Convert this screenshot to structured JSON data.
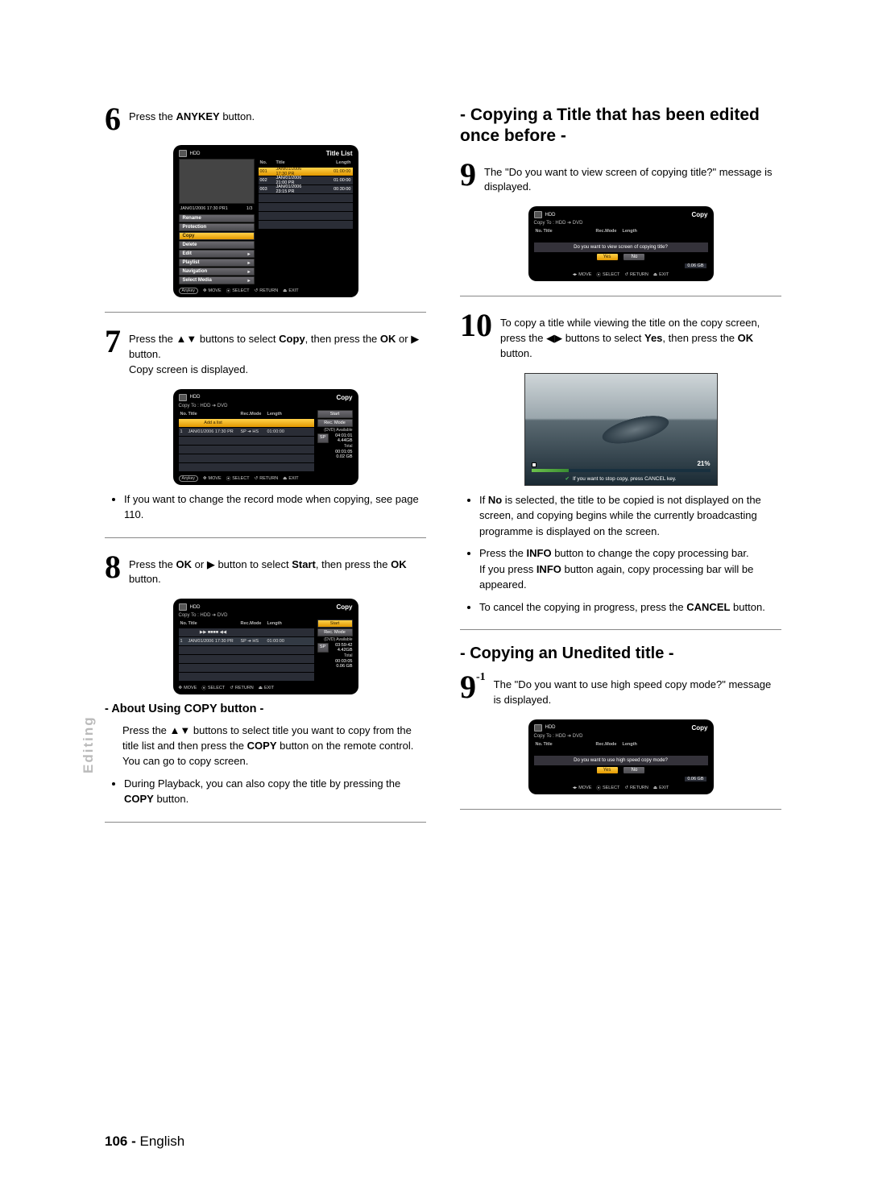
{
  "sideTab": "Editing",
  "footer": {
    "page": "106 -",
    "lang": "English"
  },
  "triUD": "▲▼",
  "triR": "▶",
  "triLR": "◀▶",
  "step6": {
    "num": "6",
    "pre": "Press the ",
    "bold": "ANYKEY",
    "post": " button.",
    "panel": {
      "hdd": "HDD",
      "rt": "Title List",
      "line1a": "JAN/01/2006 17:30 PR1",
      "line1b": "1/3",
      "cols": {
        "no": "No.",
        "title": "Title",
        "length": "Length"
      },
      "menu": [
        "Rename",
        "Protection",
        "Copy",
        "Delete",
        "Edit",
        "Playlist",
        "Navigation",
        "Select Media"
      ],
      "selectedIdx": 2,
      "rows": [
        {
          "no": "001",
          "t": "JAN/01/2006 17:30 PR",
          "len": "01:00:00"
        },
        {
          "no": "002",
          "t": "JAN/01/2006 21:00 PR",
          "len": "01:00:00"
        },
        {
          "no": "003",
          "t": "JAN/01/2006 23:15 PR",
          "len": "00:30:00"
        }
      ],
      "buttons": {
        "anykey": "Anykey",
        "move": "MOVE",
        "select": "SELECT",
        "return": "RETURN",
        "exit": "EXIT"
      }
    }
  },
  "step7": {
    "num": "7",
    "line1a": "Press the ",
    "line1b": " buttons to select ",
    "boldCopy": "Copy",
    "line1c": ", then press the ",
    "boldOK": "OK",
    "line1d": " or ",
    "line1e": " button.",
    "line2": "Copy screen is displayed.",
    "panel": {
      "hdd": "HDD",
      "rt": "Copy",
      "sub": "Copy To : HDD  ➔  DVD",
      "cols": {
        "no": "No.",
        "title": "Title",
        "rec": "Rec.Mode",
        "len": "Length"
      },
      "addlist": "Add a list",
      "row": {
        "n": "1",
        "t": "JAN/01/2006 17:30 PR",
        "r": "SP ➔ HS",
        "l": "01:00:00"
      },
      "side": {
        "start": "Start",
        "recmode": "Rec. Mode",
        "avail": "(DVD) Available",
        "sp": "SP",
        "t1": "04:01:01",
        "t2": "4.44GB",
        "tot": "Total",
        "t3": "00:01:05",
        "t4": "0.02 GB"
      },
      "buttons": {
        "anykey": "Anykey",
        "move": "MOVE",
        "select": "SELECT",
        "return": "RETURN",
        "exit": "EXIT"
      }
    },
    "note": "If you want to change the record mode when copying, see page 110."
  },
  "step8": {
    "num": "8",
    "a": "Press the ",
    "ok": "OK",
    "b": " or ",
    "c": " button to select ",
    "start": "Start",
    "d": ", then press the ",
    "ok2": "OK",
    "e": " button.",
    "panel": {
      "hdd": "HDD",
      "rt": "Copy",
      "sub": "Copy To : HDD  ➔  DVD",
      "cols": {
        "no": "No.",
        "title": "Title",
        "rec": "Rec.Mode",
        "len": "Length"
      },
      "row": {
        "n": "1",
        "t": "JAN/01/2006 17:30 PR",
        "r": "SP ➔ HS",
        "l": "01:00:00"
      },
      "marker": "▶▶  ■■■■  ◀◀",
      "side": {
        "start": "Start",
        "recmode": "Rec. Mode",
        "avail": "(DVD) Available",
        "sp": "SP",
        "t1": "03:59:42",
        "t2": "4.42GB",
        "tot": "Total",
        "t3": "00:03:05",
        "t4": "0.06 GB"
      },
      "buttons": {
        "move": "MOVE",
        "select": "SELECT",
        "return": "RETURN",
        "exit": "EXIT"
      }
    }
  },
  "copyBtn": {
    "heading": "- About Using COPY button -",
    "p1a": "Press the ",
    "p1b": " buttons to select title you want to copy from the title list and then press the ",
    "boldCOPY": "COPY",
    "p1c": " button on the remote control. You can go to copy screen.",
    "b1a": "During Playback, you can also copy the title by pressing the ",
    "boldCOPY2": "COPY",
    "b1b": " button."
  },
  "secA": {
    "heading": "- Copying a Title that has been edited once before -"
  },
  "step9": {
    "num": "9",
    "a": "The \"Do you want to view screen of copying title?\" message is displayed.",
    "panel": {
      "hdd": "HDD",
      "rt": "Copy",
      "sub": "Copy To : HDD  ➔  DVD",
      "cols": {
        "no": "No.",
        "title": "Title",
        "rec": "Rec.Mode",
        "len": "Length"
      },
      "dlg": "Do you want to view screen of copying title?",
      "yes": "Yes",
      "no": "No",
      "size": "0.06 GB",
      "buttons": {
        "move": "MOVE",
        "select": "SELECT",
        "return": "RETURN",
        "exit": "EXIT"
      }
    }
  },
  "step10": {
    "num": "10",
    "a": "To copy a title while viewing the title on the copy screen, press the ",
    "b": " buttons to select ",
    "yes": "Yes",
    "c": ", then press the ",
    "ok": "OK",
    "d": " button.",
    "photo": {
      "pct": "21%",
      "msg": "If you want to stop copy, press CANCEL key."
    },
    "bullets": {
      "i1a": "If ",
      "i1bold": "No",
      "i1b": " is selected, the title to be copied is not displayed on the screen, and copying begins while the currently broadcasting programme is displayed on the screen.",
      "i2a": "Press the ",
      "i2bold": "INFO",
      "i2b": " button to change the copy processing bar.",
      "i2la": "If you press ",
      "i2lbold": "INFO",
      "i2lb": " button again, copy processing bar will be appeared.",
      "i3a": "To cancel the copying in progress, press the ",
      "i3bold": "CANCEL",
      "i3b": " button."
    }
  },
  "secB": {
    "heading": "- Copying an Unedited title -"
  },
  "step9b": {
    "num": "9",
    "suffix": "-1",
    "a": "The \"Do you want to use high speed copy mode?\" message is displayed.",
    "panel": {
      "hdd": "HDD",
      "rt": "Copy",
      "sub": "Copy To : HDD  ➔  DVD",
      "cols": {
        "no": "No.",
        "title": "Title",
        "rec": "Rec.Mode",
        "len": "Length"
      },
      "dlg": "Do you want to use high speed copy mode?",
      "yes": "Yes",
      "no": "No",
      "size": "0.06 GB",
      "buttons": {
        "move": "MOVE",
        "select": "SELECT",
        "return": "RETURN",
        "exit": "EXIT"
      }
    }
  }
}
